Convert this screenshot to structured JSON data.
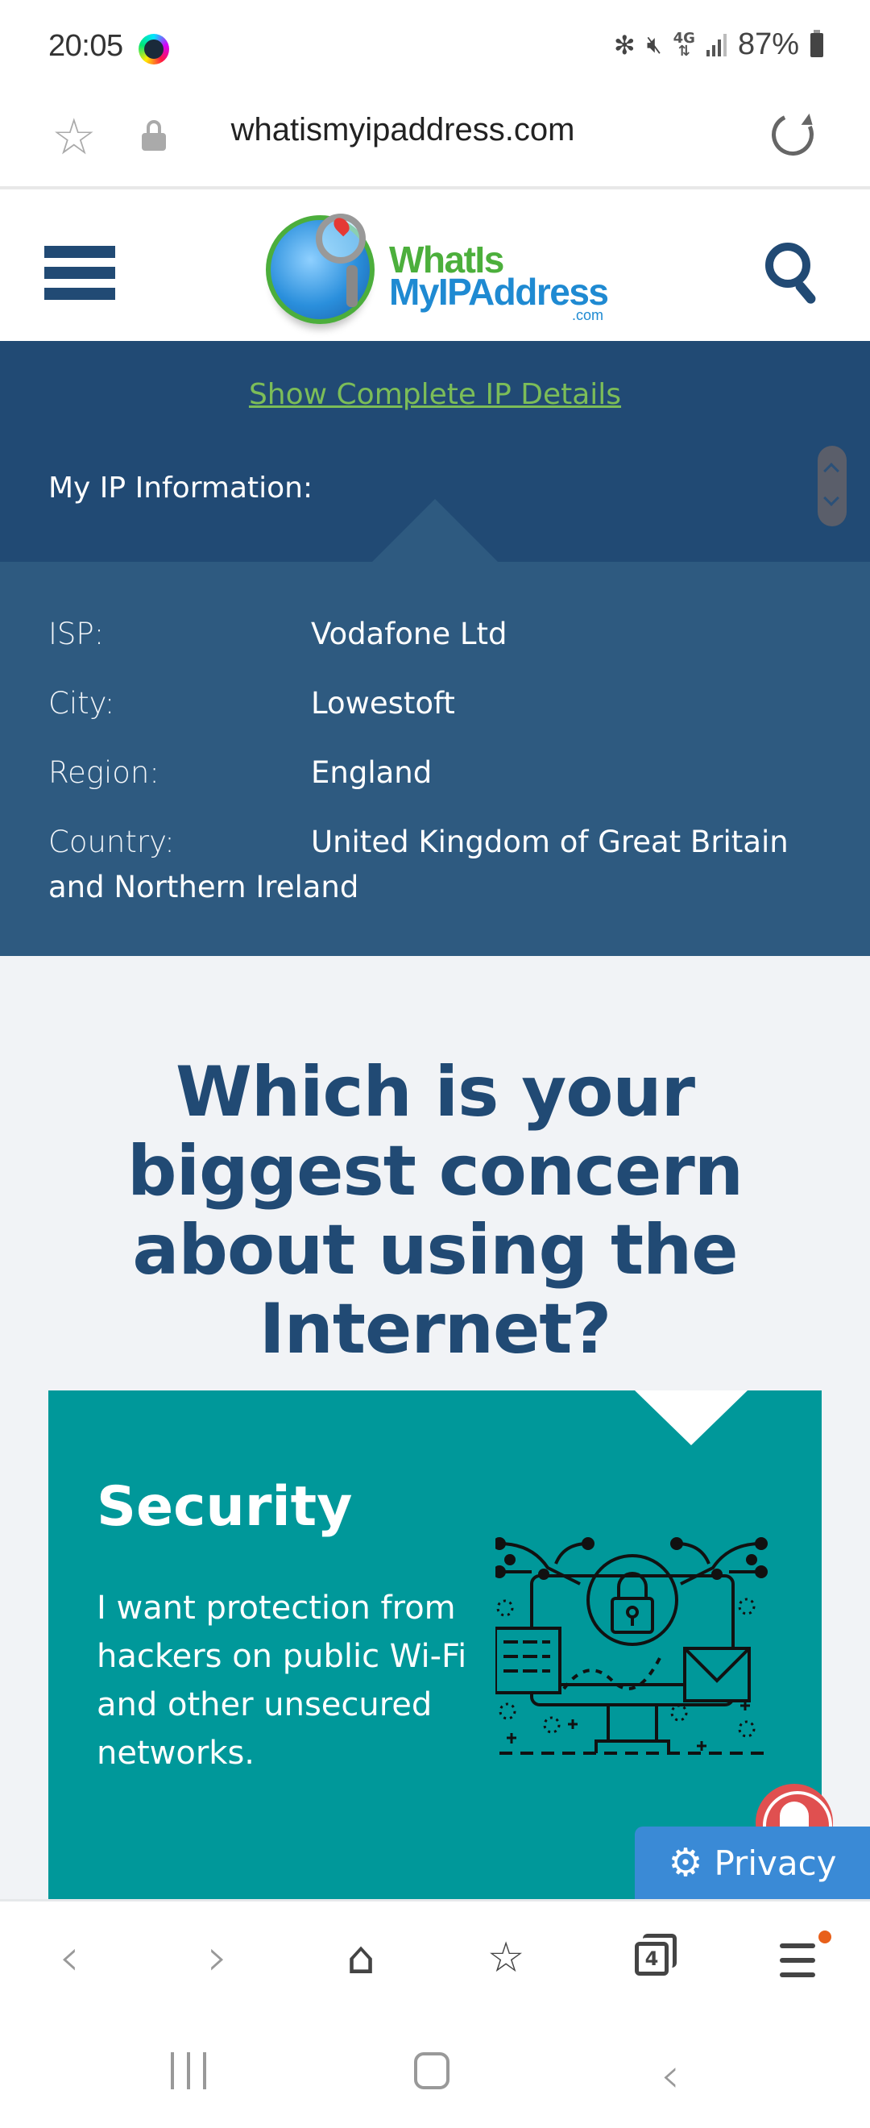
{
  "status_bar": {
    "time": "20:05",
    "network": "4G",
    "battery": "87%",
    "icons": [
      "screen-recorder-icon",
      "bluetooth-icon",
      "mute-icon",
      "network-4g-icon",
      "signal-icon",
      "battery-icon"
    ]
  },
  "browser": {
    "url": "whatismyipaddress.com",
    "tab_count": "4"
  },
  "site_header": {
    "logo_line1": "WhatIs",
    "logo_line2": "MyIPAddress",
    "logo_line3": ".com"
  },
  "ip_panel": {
    "link": "Show Complete IP Details",
    "title": "My IP Information:",
    "rows": [
      {
        "label": "ISP:",
        "value": "Vodafone Ltd"
      },
      {
        "label": "City:",
        "value": "Lowestoft"
      },
      {
        "label": "Region:",
        "value": "England"
      },
      {
        "label": "Country:",
        "value": "United Kingdom of Great Britain and Northern Ireland"
      }
    ]
  },
  "main": {
    "question": "Which is your biggest concern about using the Internet?",
    "card": {
      "title": "Security",
      "text": "I want protection from hackers on public Wi-Fi and other unsecured networks."
    }
  },
  "privacy_button": {
    "label": "Privacy"
  },
  "colors": {
    "navy": "#214a74",
    "panel_blue": "#2e5a80",
    "link_green": "#7cbd58",
    "teal": "#00989a",
    "privacy_blue": "#3a8ad6",
    "bell_red": "#e05050",
    "page_bg": "#f1f3f6"
  }
}
